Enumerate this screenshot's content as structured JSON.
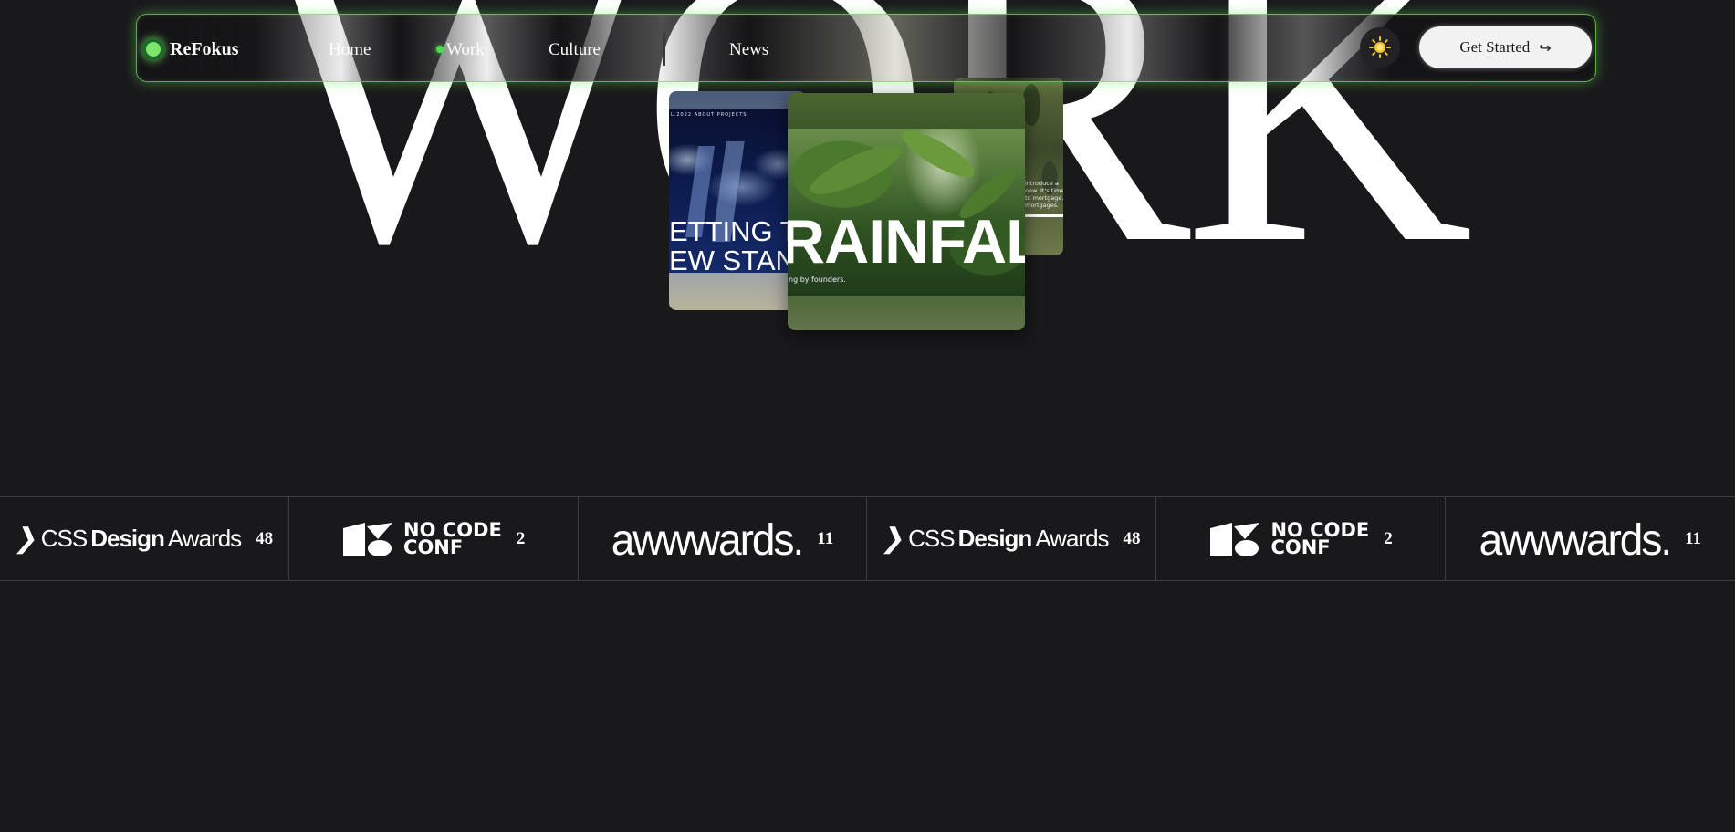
{
  "hero": {
    "word": "WORK"
  },
  "nav": {
    "logo_text": "ReFokus",
    "links": [
      {
        "label": "Home"
      },
      {
        "label": "Work",
        "active": true
      },
      {
        "label": "Culture"
      },
      {
        "label": "News"
      }
    ],
    "theme_icon": "sun-icon",
    "cta_label": "Get Started",
    "cta_arrow": "↪",
    "accent_color": "#7ee66b"
  },
  "cards": {
    "back": {
      "snippet": "introduce a new. It's time to mortgage. mortgages."
    },
    "middle": {
      "nav_text": "L.2022 ABOUT PROJECTS",
      "headline_line1": "ETTING T",
      "headline_line2": "EW STAN"
    },
    "front": {
      "headline": "RAINFALL",
      "tagline": "ng by founders."
    }
  },
  "awards": [
    {
      "brand": "CSS Design Awards",
      "logo": "cssda",
      "count": "48"
    },
    {
      "brand": "NO CODE CONF",
      "logo": "nocode",
      "count": "2"
    },
    {
      "brand": "awwwards.",
      "logo": "awwwards",
      "count": "11"
    },
    {
      "brand": "CSS Design Awards",
      "logo": "cssda",
      "count": "48"
    },
    {
      "brand": "NO CODE CONF",
      "logo": "nocode",
      "count": "2"
    },
    {
      "brand": "awwwards.",
      "logo": "awwwards",
      "count": "11"
    }
  ],
  "award_text": {
    "cssda_css": "CSS",
    "cssda_design": "Design",
    "cssda_awards": "Awards",
    "nocode_line1": "NO  CODE",
    "nocode_line2": "CONF"
  },
  "colors": {
    "background": "#19191b",
    "nav_glow": "#7ee66b",
    "active_dot": "#4ddc4d"
  }
}
